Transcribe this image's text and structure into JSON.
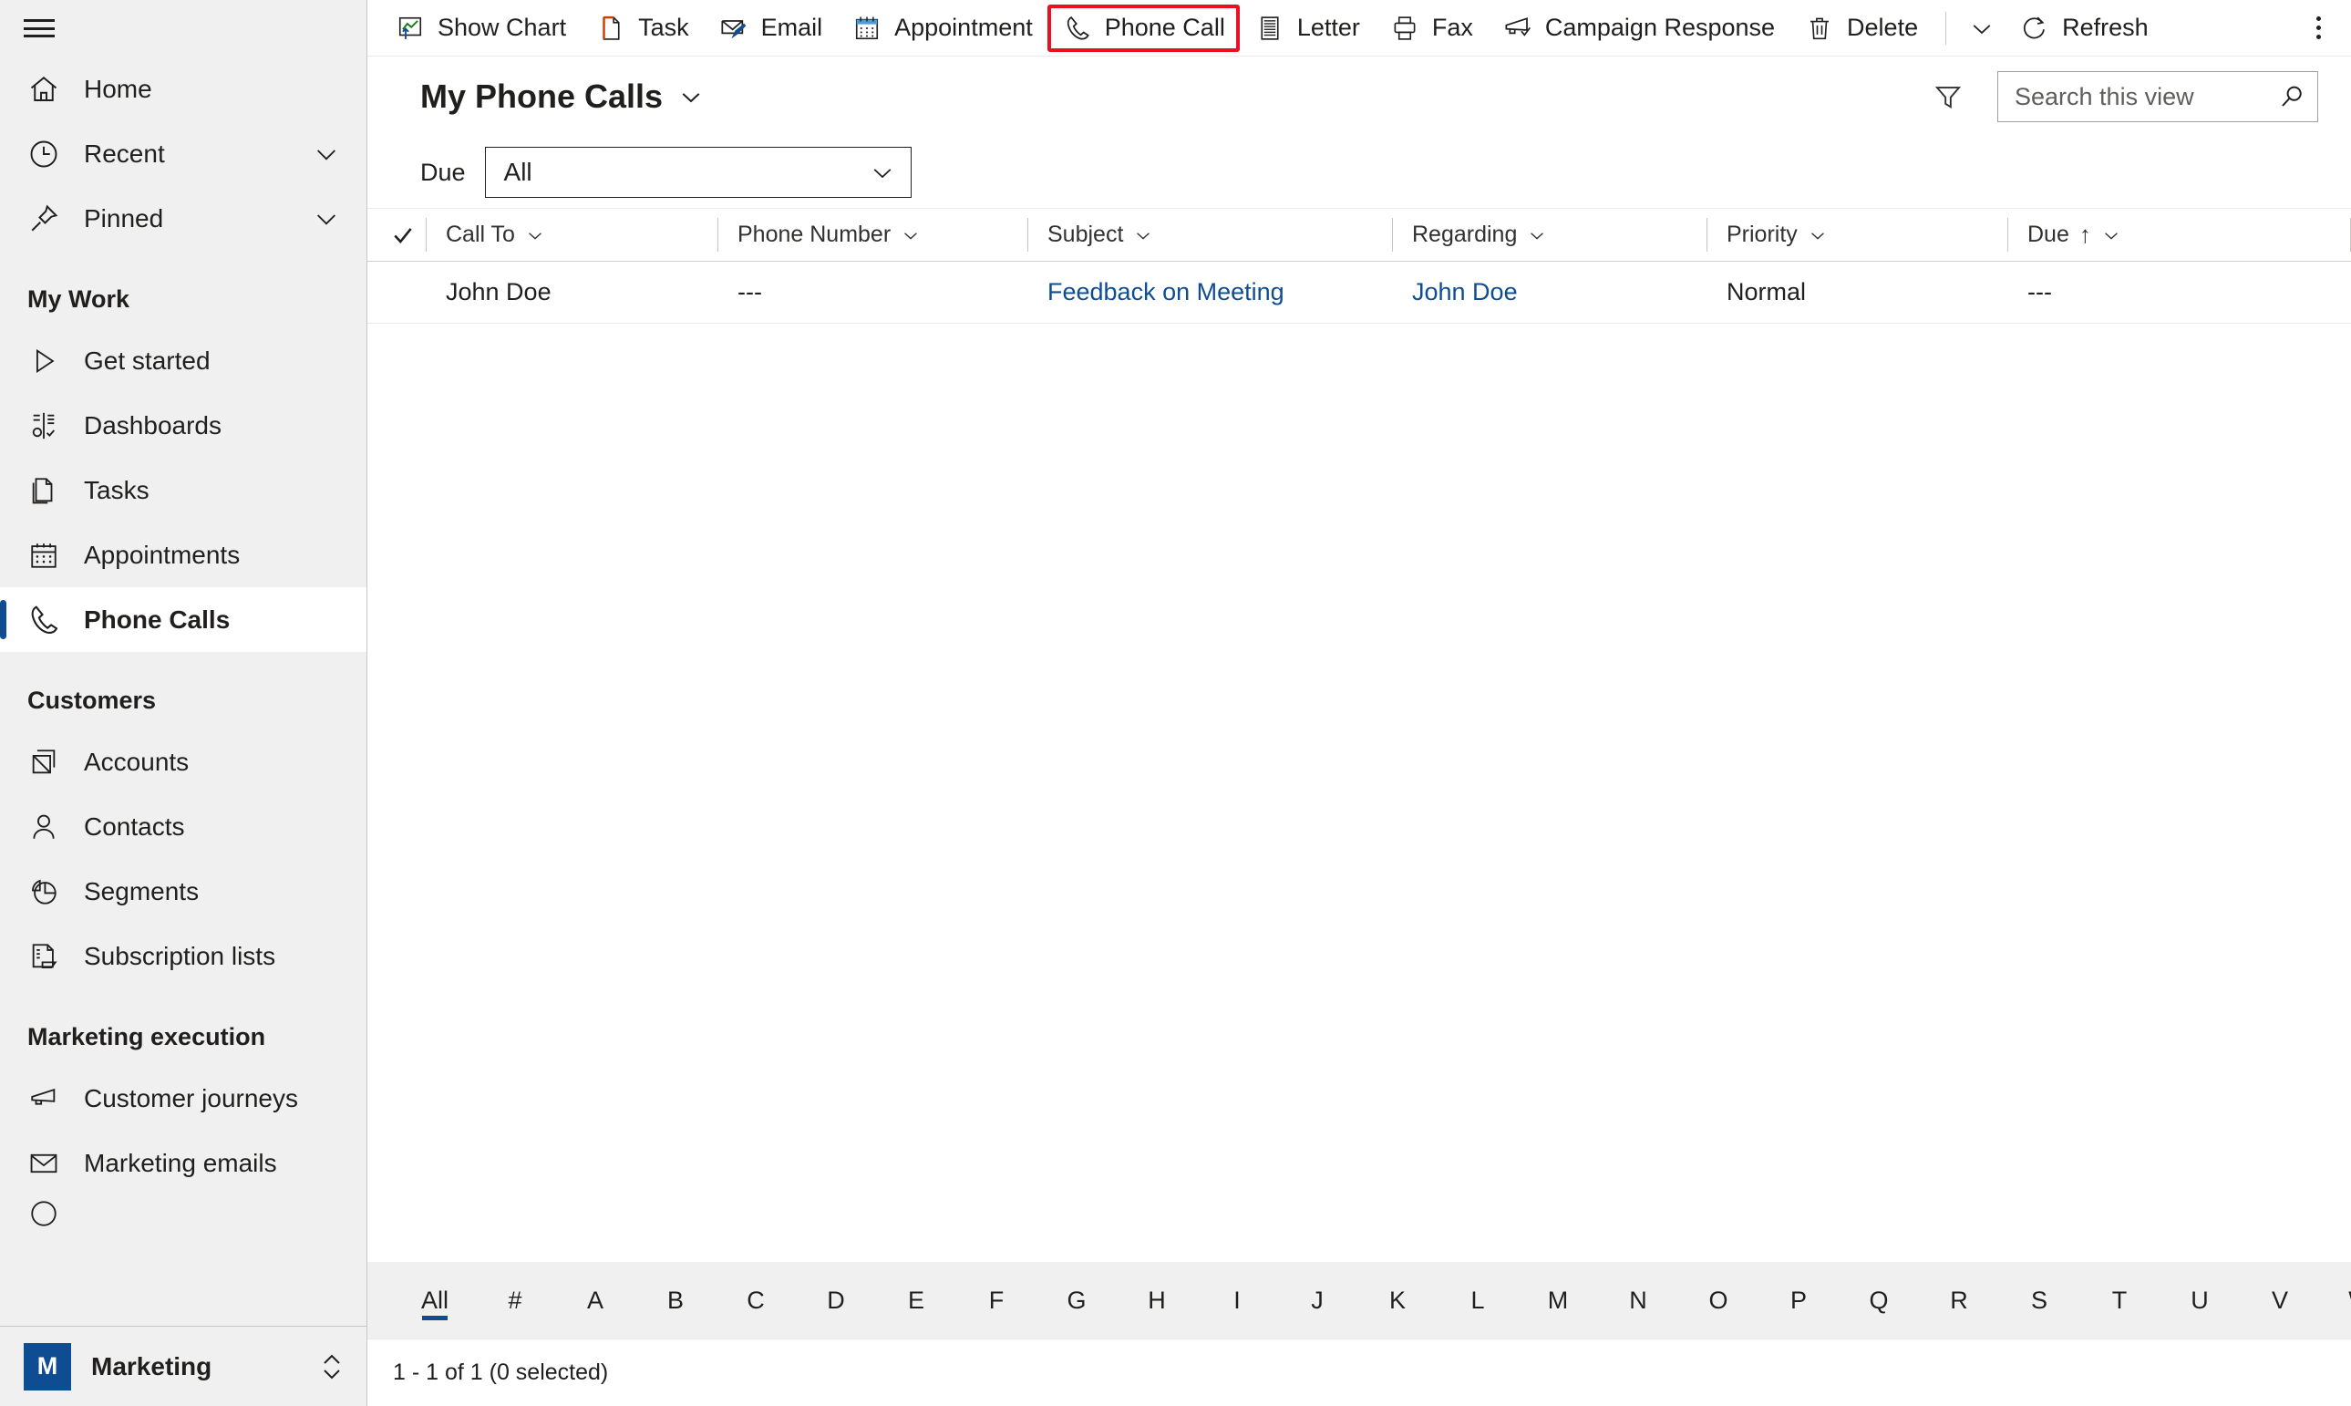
{
  "colors": {
    "accent": "#0f4d92",
    "highlight": "#e81123",
    "sidebar_bg": "#f0f0f0",
    "selected_bg": "#ffffff",
    "link": "#0f4d92"
  },
  "sidebar": {
    "hamburger_label": "Site map",
    "top_items": [
      {
        "label": "Home",
        "icon": "home-icon",
        "chevron": false,
        "name": "home"
      },
      {
        "label": "Recent",
        "icon": "clock-icon",
        "chevron": true,
        "name": "recent"
      },
      {
        "label": "Pinned",
        "icon": "pin-icon",
        "chevron": true,
        "name": "pinned"
      }
    ],
    "groups": [
      {
        "header": "My Work",
        "items": [
          {
            "label": "Get started",
            "icon": "play-icon",
            "selected": false,
            "name": "get-started"
          },
          {
            "label": "Dashboards",
            "icon": "dashboard-icon",
            "selected": false,
            "name": "dashboards"
          },
          {
            "label": "Tasks",
            "icon": "task-icon",
            "selected": false,
            "name": "tasks"
          },
          {
            "label": "Appointments",
            "icon": "calendar-icon",
            "selected": false,
            "name": "appointments"
          },
          {
            "label": "Phone Calls",
            "icon": "phone-icon",
            "selected": true,
            "name": "phone-calls"
          }
        ]
      },
      {
        "header": "Customers",
        "items": [
          {
            "label": "Accounts",
            "icon": "accounts-icon",
            "selected": false,
            "name": "accounts"
          },
          {
            "label": "Contacts",
            "icon": "contact-icon",
            "selected": false,
            "name": "contacts"
          },
          {
            "label": "Segments",
            "icon": "segments-icon",
            "selected": false,
            "name": "segments"
          },
          {
            "label": "Subscription lists",
            "icon": "subscription-list-icon",
            "selected": false,
            "name": "subscription-lists"
          }
        ]
      },
      {
        "header": "Marketing execution",
        "items": [
          {
            "label": "Customer journeys",
            "icon": "megaphone-icon",
            "selected": false,
            "name": "customer-journeys"
          },
          {
            "label": "Marketing emails",
            "icon": "envelope-icon",
            "selected": false,
            "name": "marketing-emails"
          }
        ]
      }
    ],
    "app_switcher": {
      "badge": "M",
      "name": "Marketing"
    }
  },
  "commandbar": {
    "items": [
      {
        "label": "Show Chart",
        "icon": "chart-icon",
        "name": "show-chart",
        "highlighted": false
      },
      {
        "label": "Task",
        "icon": "task-icon",
        "name": "new-task",
        "highlighted": false
      },
      {
        "label": "Email",
        "icon": "email-icon",
        "name": "new-email",
        "highlighted": false
      },
      {
        "label": "Appointment",
        "icon": "appointment-icon",
        "name": "new-appointment",
        "highlighted": false
      },
      {
        "label": "Phone Call",
        "icon": "phone-icon",
        "name": "new-phone-call",
        "highlighted": true
      },
      {
        "label": "Letter",
        "icon": "letter-icon",
        "name": "new-letter",
        "highlighted": false
      },
      {
        "label": "Fax",
        "icon": "fax-icon",
        "name": "new-fax",
        "highlighted": false
      },
      {
        "label": "Campaign Response",
        "icon": "megaphone-icon",
        "name": "campaign-response",
        "highlighted": false
      },
      {
        "label": "Delete",
        "icon": "trash-icon",
        "name": "delete",
        "highlighted": false
      }
    ],
    "more_commands_label": "More commands",
    "refresh": {
      "label": "Refresh",
      "icon": "refresh-icon"
    },
    "overflow_label": "More"
  },
  "view": {
    "title": "My Phone Calls",
    "title_chevron": "chevron-down-icon",
    "filter_icon": "funnel-icon",
    "search": {
      "placeholder": "Search this view",
      "value": "",
      "icon": "search-icon"
    }
  },
  "filter_row": {
    "label": "Due",
    "dropdown_value": "All",
    "dropdown_icon": "chevron-down-icon"
  },
  "grid": {
    "columns": [
      {
        "label": "Call To",
        "sort": "",
        "name": "call-to"
      },
      {
        "label": "Phone Number",
        "sort": "",
        "name": "phone-number"
      },
      {
        "label": "Subject",
        "sort": "",
        "name": "subject"
      },
      {
        "label": "Regarding",
        "sort": "",
        "name": "regarding"
      },
      {
        "label": "Priority",
        "sort": "",
        "name": "priority"
      },
      {
        "label": "Due",
        "sort": "↑",
        "name": "due"
      }
    ],
    "rows": [
      {
        "call_to": "John Doe",
        "phone_number": "---",
        "subject": "Feedback on Meeting",
        "regarding": "John Doe",
        "priority": "Normal",
        "due": "---"
      }
    ]
  },
  "alphabet": {
    "items": [
      "All",
      "#",
      "A",
      "B",
      "C",
      "D",
      "E",
      "F",
      "G",
      "H",
      "I",
      "J",
      "K",
      "L",
      "M",
      "N",
      "O",
      "P",
      "Q",
      "R",
      "S",
      "T",
      "U",
      "V",
      "W"
    ],
    "active": "All"
  },
  "footer": {
    "status": "1 - 1 of 1 (0 selected)"
  }
}
